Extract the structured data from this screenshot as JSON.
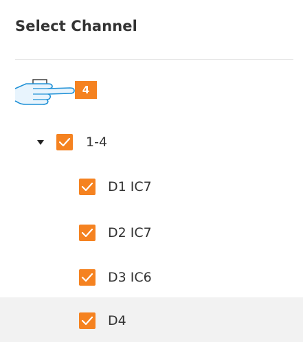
{
  "panel": {
    "title": "Select Channel"
  },
  "drag": {
    "icon": "hand-pointer-icon",
    "count": "4"
  },
  "tree": {
    "group": {
      "label": "1-4",
      "expanded": true,
      "checked": true
    },
    "items": [
      {
        "label": "D1 IC7",
        "checked": true
      },
      {
        "label": "D2 IC7",
        "checked": true
      },
      {
        "label": "D3 IC6",
        "checked": true
      },
      {
        "label": "D4",
        "checked": true
      }
    ]
  },
  "colors": {
    "accent": "#f58220",
    "hover_row": "#f2f2f2",
    "hand_outline": "#1e90d6"
  }
}
